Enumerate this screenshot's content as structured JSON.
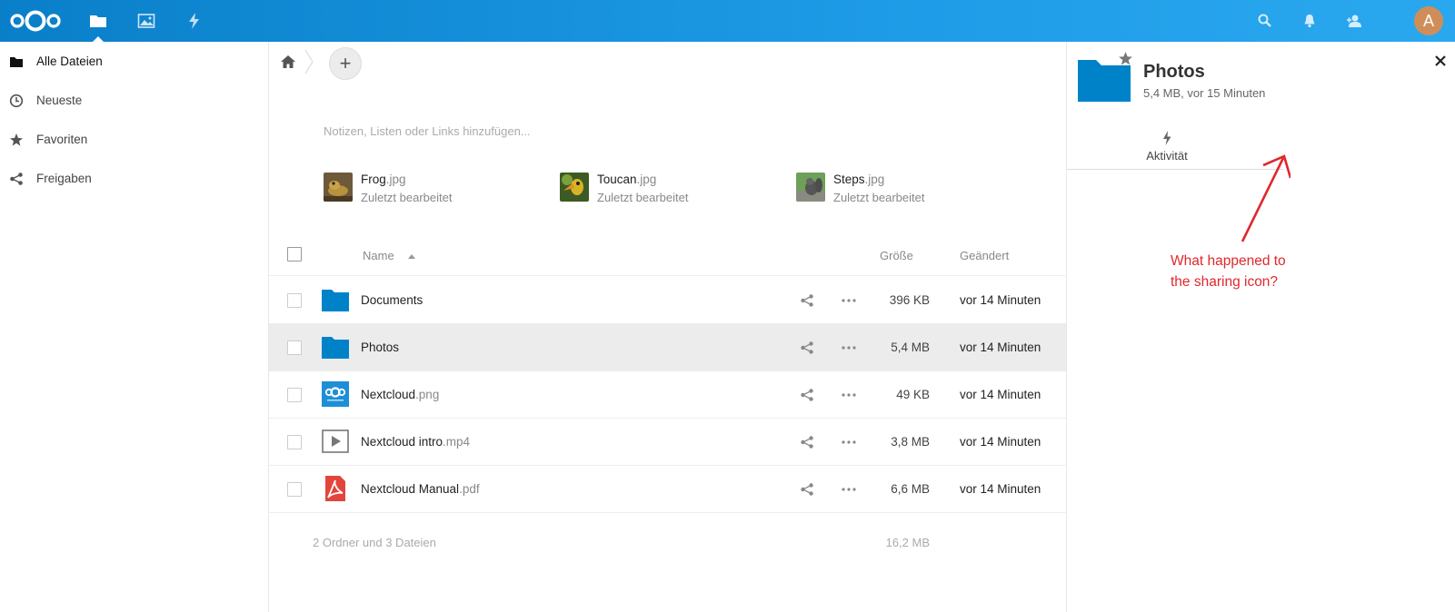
{
  "header": {
    "apps": [
      "files-icon",
      "photos-icon",
      "activity-icon"
    ],
    "right_icons": [
      "search-icon",
      "bell-icon",
      "contacts-icon"
    ],
    "avatar_letter": "A",
    "colors": {
      "bar": "#1e9be6",
      "avatar": "#cf8e59"
    }
  },
  "sidebar": {
    "items": [
      {
        "label": "Alle Dateien",
        "icon": "folder-icon"
      },
      {
        "label": "Neueste",
        "icon": "clock-icon"
      },
      {
        "label": "Favoriten",
        "icon": "star-icon"
      },
      {
        "label": "Freigaben",
        "icon": "share-icon"
      }
    ]
  },
  "main": {
    "add_label": "+",
    "notes_placeholder": "Notizen, Listen oder Links hinzufügen...",
    "recent": [
      {
        "name": "Frog",
        "ext": ".jpg",
        "sub": "Zuletzt bearbeitet"
      },
      {
        "name": "Toucan",
        "ext": ".jpg",
        "sub": "Zuletzt bearbeitet"
      },
      {
        "name": "Steps",
        "ext": ".jpg",
        "sub": "Zuletzt bearbeitet"
      }
    ],
    "columns": {
      "name": "Name",
      "size": "Größe",
      "modified": "Geändert"
    },
    "files": [
      {
        "name": "Documents",
        "ext": "",
        "size": "396 KB",
        "modified": "vor 14 Minuten",
        "icon": "folder-icon"
      },
      {
        "name": "Photos",
        "ext": "",
        "size": "5,4 MB",
        "modified": "vor 14 Minuten",
        "icon": "folder-icon"
      },
      {
        "name": "Nextcloud",
        "ext": ".png",
        "size": "49 KB",
        "modified": "vor 14 Minuten",
        "icon": "image-icon"
      },
      {
        "name": "Nextcloud intro",
        "ext": ".mp4",
        "size": "3,8 MB",
        "modified": "vor 14 Minuten",
        "icon": "video-icon"
      },
      {
        "name": "Nextcloud Manual",
        "ext": ".pdf",
        "size": "6,6 MB",
        "modified": "vor 14 Minuten",
        "icon": "pdf-icon"
      }
    ],
    "summary": "2 Ordner und 3 Dateien",
    "summary_size": "16,2 MB"
  },
  "panel": {
    "title": "Photos",
    "subtitle": "5,4 MB, vor 15 Minuten",
    "tab_activity": "Aktivität",
    "colors": {
      "folder": "#0082c9"
    }
  },
  "annotation": {
    "line1": "What happened to",
    "line2": "the sharing icon?",
    "color": "#e0282c"
  }
}
